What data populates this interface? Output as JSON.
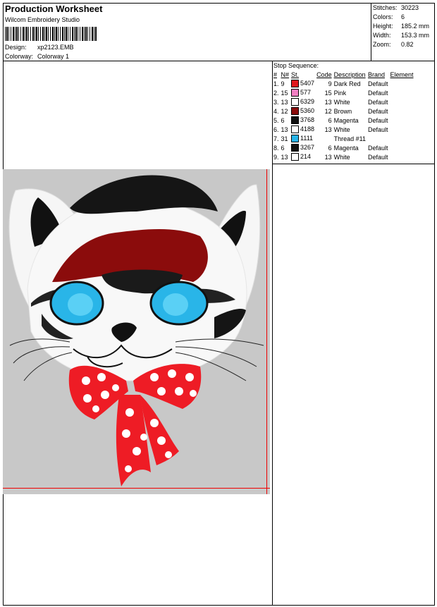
{
  "header": {
    "title": "Production Worksheet",
    "subtitle": "Wilcom Embroidery Studio",
    "design_label": "Design:",
    "design_value": "xp2123.EMB",
    "colorway_label": "Colorway:",
    "colorway_value": "Colorway 1"
  },
  "stats": [
    {
      "label": "Stitches:",
      "value": "30223"
    },
    {
      "label": "Colors:",
      "value": "6"
    },
    {
      "label": "Height:",
      "value": "185.2 mm"
    },
    {
      "label": "Width:",
      "value": "153.3 mm"
    },
    {
      "label": "Zoom:",
      "value": "0.82"
    }
  ],
  "stop_sequence": {
    "caption": "Stop Sequence:",
    "columns": [
      "#",
      "N#",
      "St.",
      "Code",
      "Description",
      "Brand",
      "Element"
    ],
    "rows": [
      {
        "idx": "1.",
        "n": "9",
        "color": "#e0171d",
        "st": "5407",
        "code": "9",
        "desc": "Dark Red",
        "brand": "Default"
      },
      {
        "idx": "2.",
        "n": "15",
        "color": "#f27fc3",
        "st": "577",
        "code": "15",
        "desc": "Pink",
        "brand": "Default"
      },
      {
        "idx": "3.",
        "n": "13",
        "color": "#ffffff",
        "st": "6329",
        "code": "13",
        "desc": "White",
        "brand": "Default"
      },
      {
        "idx": "4.",
        "n": "12",
        "color": "#8b0c0c",
        "st": "5360",
        "code": "12",
        "desc": "Brown",
        "brand": "Default"
      },
      {
        "idx": "5.",
        "n": "6",
        "color": "#111111",
        "st": "3768",
        "code": "6",
        "desc": "Magenta",
        "brand": "Default"
      },
      {
        "idx": "6.",
        "n": "13",
        "color": "#ffffff",
        "st": "4188",
        "code": "13",
        "desc": "White",
        "brand": "Default"
      },
      {
        "idx": "7.",
        "n": "31",
        "color": "#29b5e8",
        "st": "1111",
        "code": "",
        "desc": "Thread #11",
        "brand": ""
      },
      {
        "idx": "8.",
        "n": "6",
        "color": "#111111",
        "st": "3267",
        "code": "6",
        "desc": "Magenta",
        "brand": "Default"
      },
      {
        "idx": "9.",
        "n": "13",
        "color": "#ffffff",
        "st": "214",
        "code": "13",
        "desc": "White",
        "brand": "Default"
      }
    ]
  },
  "colors": {
    "background": "#c8c8c8",
    "guide": "#e00000"
  }
}
